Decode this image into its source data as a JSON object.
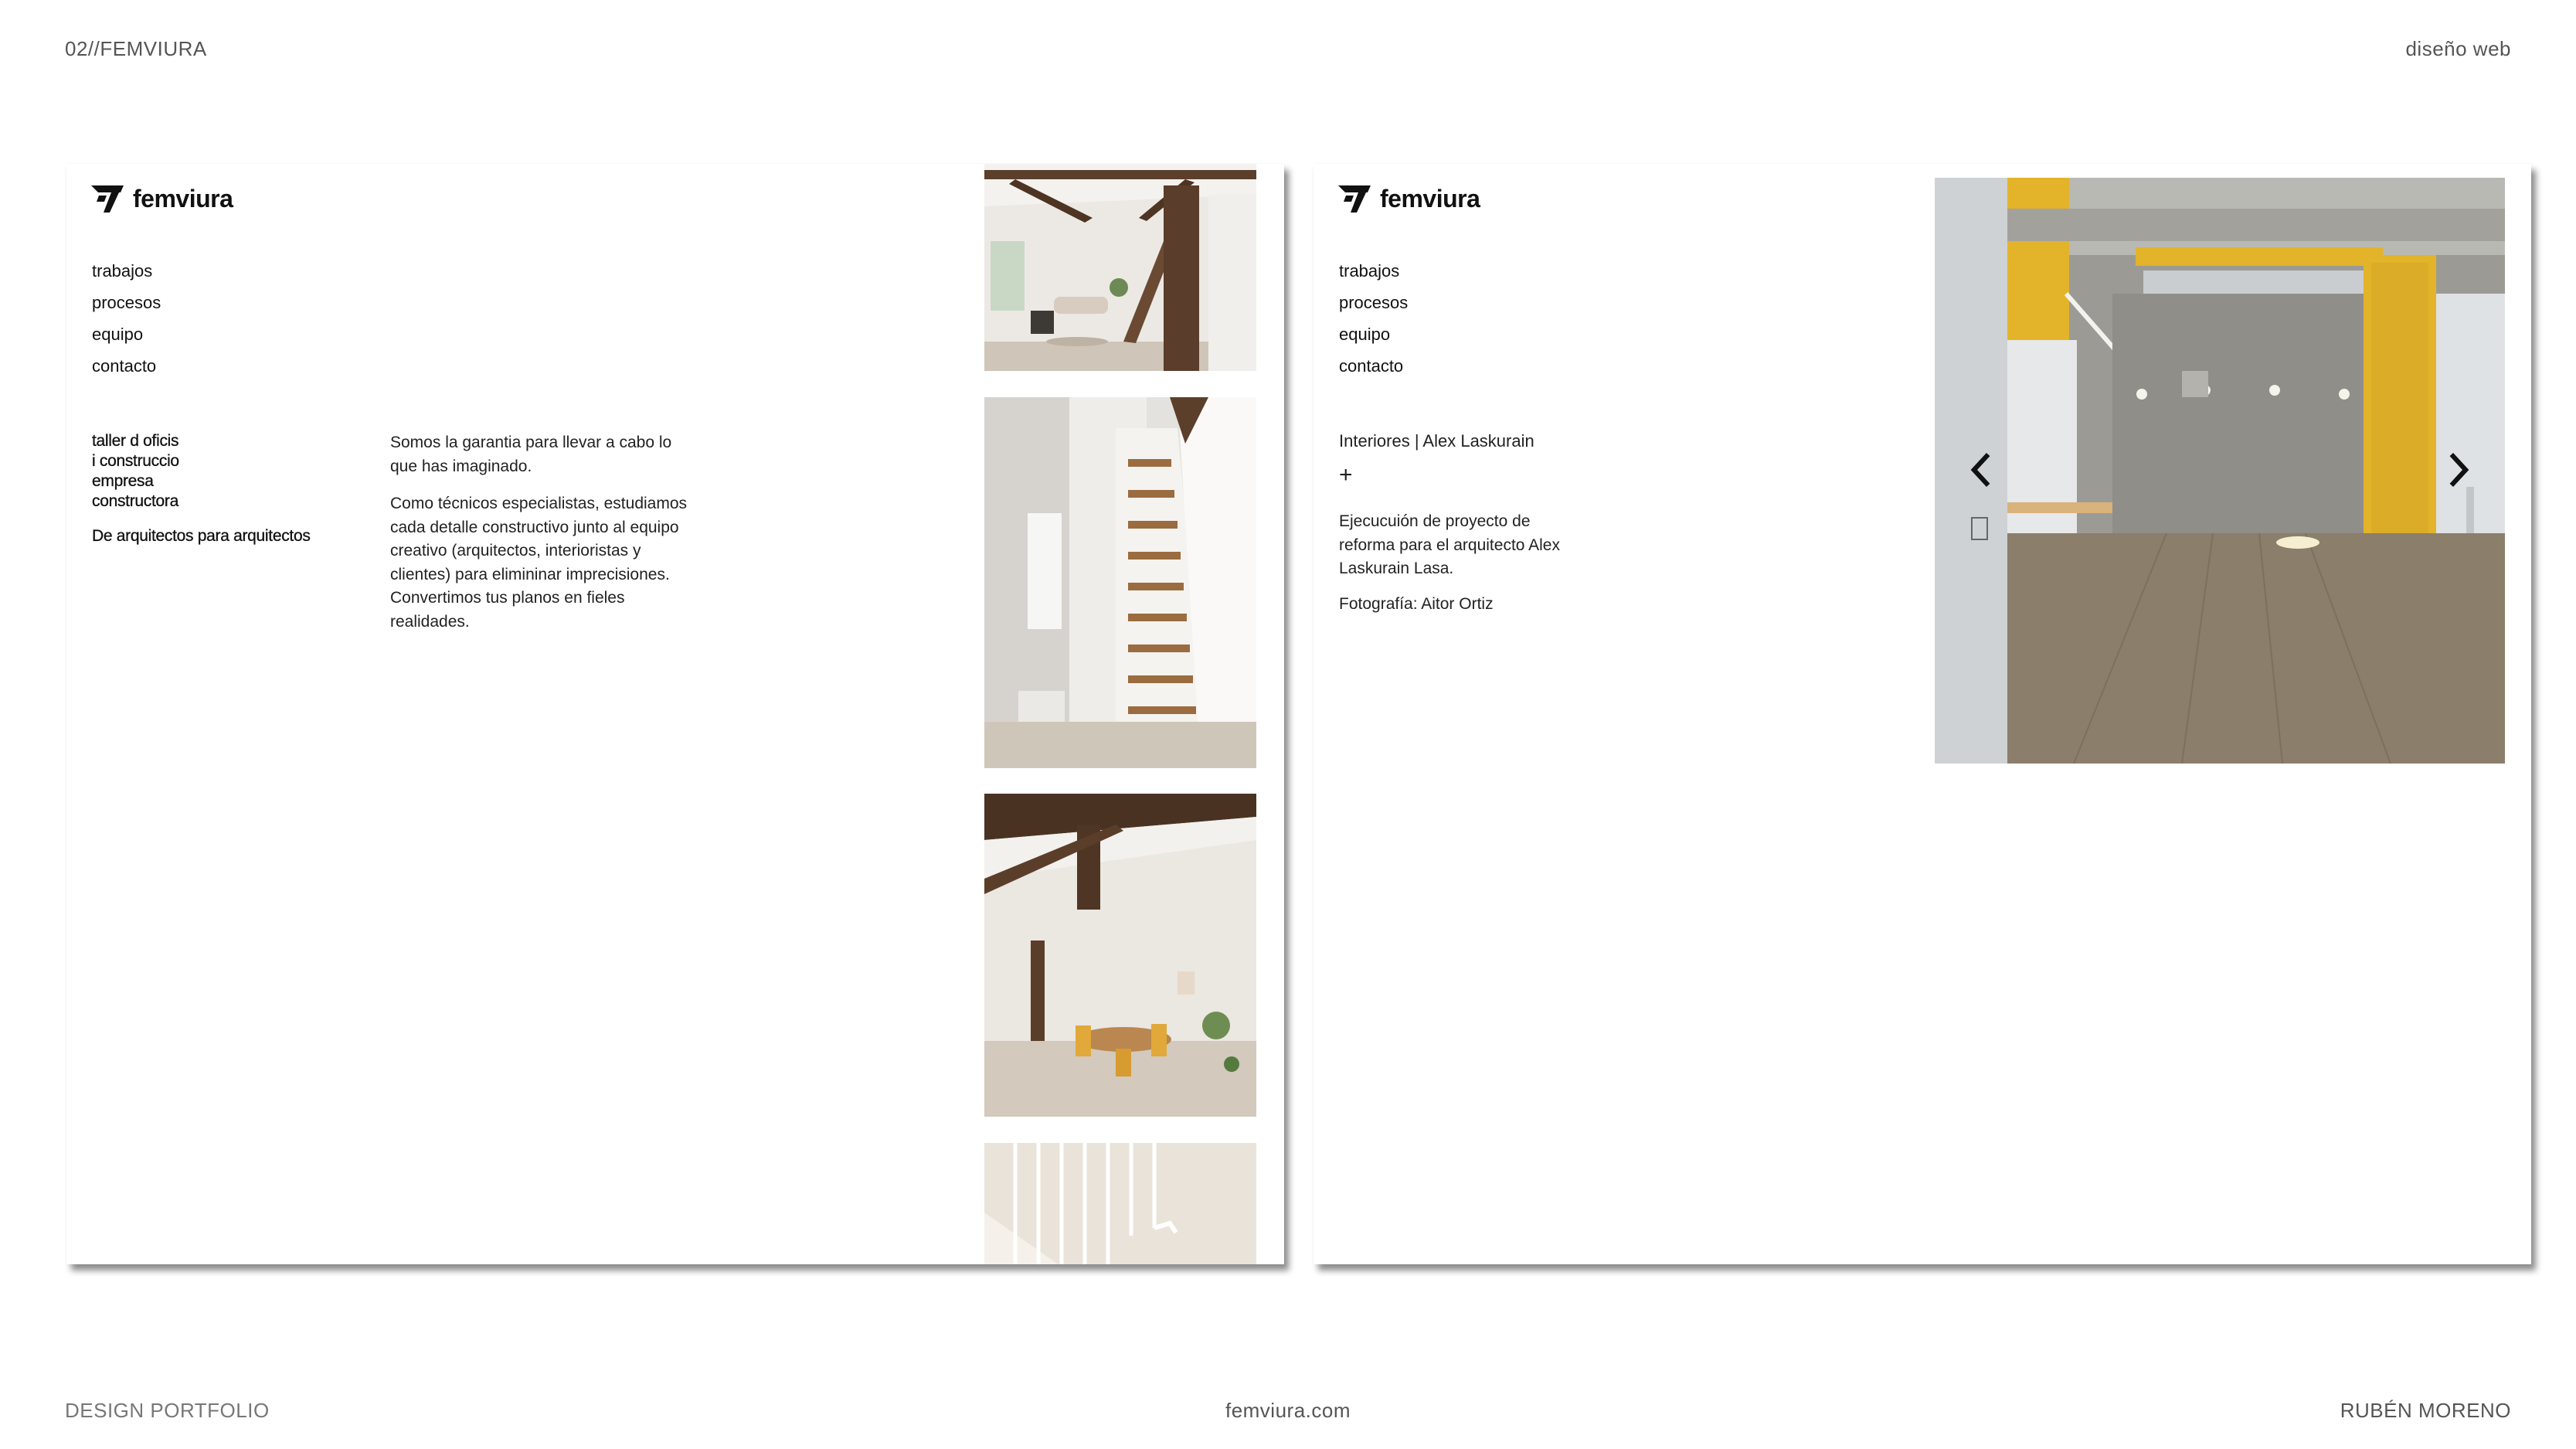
{
  "header": {
    "left": "02//FEMVIURA",
    "right": "diseño web"
  },
  "footer": {
    "left": "DESIGN PORTFOLIO",
    "center": "femviura.com",
    "right": "RUBÉN MORENO"
  },
  "brand": {
    "name": "femviura"
  },
  "nav": [
    "trabajos",
    "procesos",
    "equipo",
    "contacto"
  ],
  "home": {
    "tags": [
      "taller d oficis",
      "i construccio",
      "empresa",
      "constructora"
    ],
    "tagline": "De arquitectos para arquitectos",
    "paragraph1": "Somos la garantia para llevar a cabo lo que has imaginado.",
    "paragraph2": "Como técnicos especialistas, estudiamos cada detalle constructivo junto al equipo creativo (arquitectos, interioristas y clientes) para elimininar imprecisiones.",
    "paragraph3": "Convertimos tus planos en fieles realidades."
  },
  "project": {
    "title": "Interiores | Alex Laskurain",
    "expand": "+",
    "description": "Ejecucuión de proyecto de reforma para el arquitecto Alex Laskurain Lasa.",
    "credit": "Fotografía: Aitor Ortiz"
  },
  "colors": {
    "accent_yellow": "#e3b32a",
    "concrete": "#8f8e88",
    "wood_floor": "#8a7c68",
    "beam_wood": "#5a3f2b"
  },
  "icons": {
    "prev": "chevron-left-icon",
    "next": "chevron-right-icon",
    "logo": "femviura-logo-icon"
  }
}
